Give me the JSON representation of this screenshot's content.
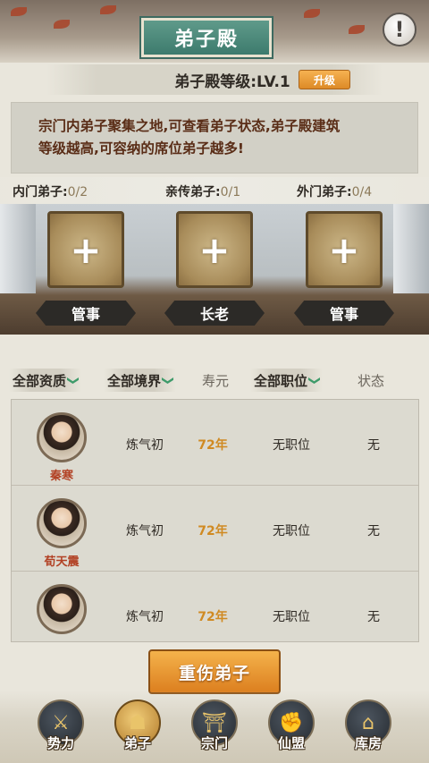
{
  "header": {
    "title": "弟子殿",
    "help_icon": "question-icon",
    "help_symbol": "!"
  },
  "level": {
    "label": "弟子殿等级:LV.1",
    "upgrade_label": "升级"
  },
  "description": {
    "line1": "宗门内弟子聚集之地,可查看弟子状态,弟子殿建筑",
    "line2": "等级越高,可容纳的席位弟子越多!"
  },
  "counts": [
    {
      "label": "内门弟子:",
      "value": "0/2"
    },
    {
      "label": "亲传弟子:",
      "value": "0/1"
    },
    {
      "label": "外门弟子:",
      "value": "0/4"
    }
  ],
  "slots": [
    {
      "role": "管事",
      "plus": "+"
    },
    {
      "role": "长老",
      "plus": "+"
    },
    {
      "role": "管事",
      "plus": "+"
    }
  ],
  "filters": {
    "quality": "全部资质",
    "realm": "全部境界",
    "lifespan": "寿元",
    "position": "全部职位",
    "status": "状态",
    "chevron": "❯"
  },
  "disciples": [
    {
      "name": "秦寒",
      "realm": "炼气初",
      "age": "72年",
      "position": "无职位",
      "status": "无"
    },
    {
      "name": "荀天震",
      "realm": "炼气初",
      "age": "72年",
      "position": "无职位",
      "status": "无"
    },
    {
      "name": "",
      "realm": "炼气初",
      "age": "72年",
      "position": "无职位",
      "status": "无"
    }
  ],
  "action": {
    "label": "重伤弟子"
  },
  "nav": [
    {
      "label": "势力",
      "icon": "weapons-icon",
      "glyph": "⚔"
    },
    {
      "label": "弟子",
      "icon": "disciple-hat-icon",
      "glyph": "☗"
    },
    {
      "label": "宗门",
      "icon": "gate-icon",
      "glyph": "⛩"
    },
    {
      "label": "仙盟",
      "icon": "fist-icon",
      "glyph": "✊"
    },
    {
      "label": "库房",
      "icon": "storehouse-icon",
      "glyph": "⌂"
    }
  ],
  "colors": {
    "accent": "#e38f2b",
    "title_plate": "#4c8a7b",
    "name_red": "#b24124",
    "age_orange": "#d08a22",
    "chevron_green": "#3e9b6a"
  }
}
